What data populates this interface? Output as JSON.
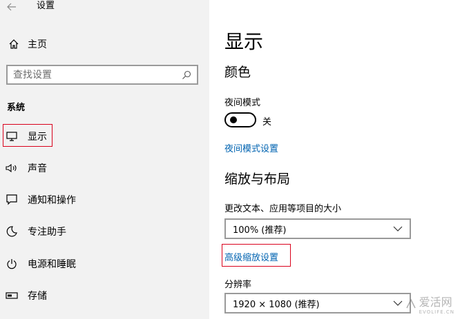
{
  "window": {
    "title": "设置"
  },
  "sidebar": {
    "home_label": "主页",
    "search": {
      "placeholder": "查找设置"
    },
    "section_label": "系统",
    "items": [
      {
        "label": "显示",
        "icon": "monitor-icon"
      },
      {
        "label": "声音",
        "icon": "speaker-icon"
      },
      {
        "label": "通知和操作",
        "icon": "message-icon"
      },
      {
        "label": "专注助手",
        "icon": "moon-icon"
      },
      {
        "label": "电源和睡眠",
        "icon": "power-icon"
      },
      {
        "label": "存储",
        "icon": "storage-icon"
      }
    ]
  },
  "main": {
    "page_title": "显示",
    "color_heading": "颜色",
    "night_mode_label": "夜间模式",
    "night_mode_state": "关",
    "night_mode_settings_link": "夜间模式设置",
    "scale_heading": "缩放与布局",
    "text_size_label": "更改文本、应用等项目的大小",
    "text_size_value": "100% (推荐)",
    "advanced_scale_link": "高级缩放设置",
    "resolution_label": "分辨率",
    "resolution_value": "1920 × 1080 (推荐)"
  },
  "watermark": {
    "text": "爱活网",
    "sub": "EVOLIFE.CN"
  },
  "colors": {
    "accent": "#0063b1",
    "highlight": "#d9001b",
    "sidebar_bg": "#f2f2f2"
  }
}
